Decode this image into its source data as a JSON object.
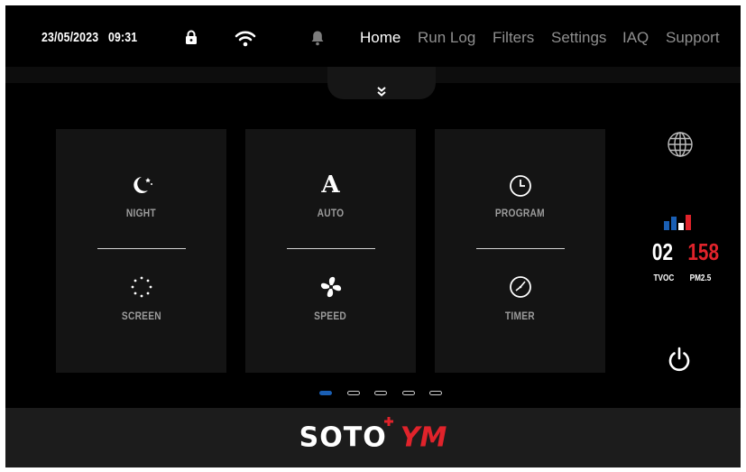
{
  "status": {
    "date": "23/05/2023",
    "time": "09:31"
  },
  "icons": {
    "lock": "lock-icon",
    "wifi": "wifi-icon",
    "bell": "bell-icon",
    "globe": "globe-icon",
    "power": "power-icon"
  },
  "nav": [
    {
      "label": "Home",
      "active": true
    },
    {
      "label": "Run Log"
    },
    {
      "label": "Filters"
    },
    {
      "label": "Settings"
    },
    {
      "label": "IAQ"
    },
    {
      "label": "Support"
    }
  ],
  "cards": [
    {
      "top_label": "NIGHT",
      "top_icon": "moon-stars-icon",
      "bottom_label": "SCREEN",
      "bottom_icon": "screen-dots-icon"
    },
    {
      "top_label": "AUTO",
      "top_icon": "auto-a-icon",
      "top_glyph": "A",
      "bottom_label": "SPEED",
      "bottom_icon": "fan-icon"
    },
    {
      "top_label": "PROGRAM",
      "top_icon": "clock-icon",
      "bottom_label": "TIMER",
      "bottom_icon": "timer-icon"
    }
  ],
  "air_quality": {
    "tvoc_value": "02",
    "tvoc_label": "TVOC",
    "pm_value": "158",
    "pm_label": "PM2.5",
    "colors": {
      "tvoc": "#ffffff",
      "pm": "#e0232b",
      "bars": [
        "#1a5fb4",
        "#1a5fb4",
        "#ffffff",
        "#e0232b"
      ]
    }
  },
  "pagination": {
    "count": 5,
    "active": 0
  },
  "brand": {
    "part1": "SOTO",
    "part2": "YM",
    "colors": {
      "part1": "#ffffff",
      "part2": "#e0232b"
    }
  }
}
